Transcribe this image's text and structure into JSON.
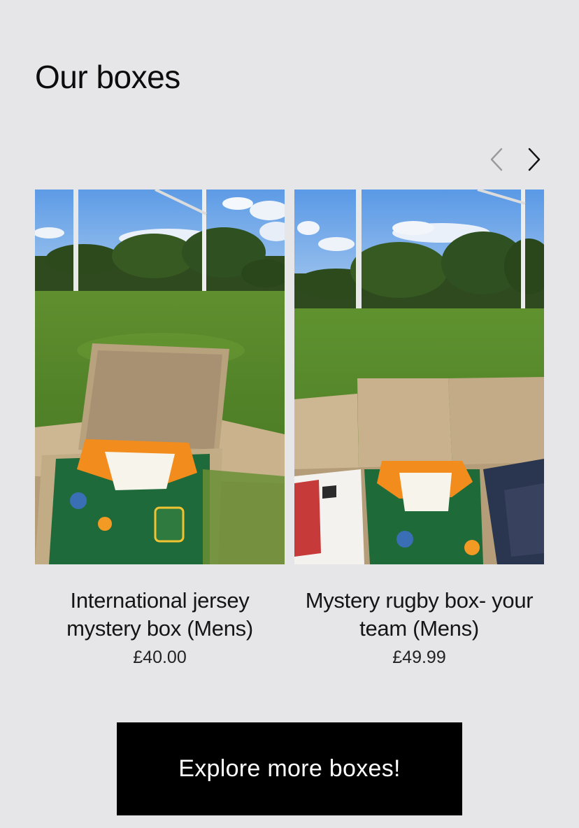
{
  "section": {
    "title": "Our boxes"
  },
  "carousel": {
    "prev_icon": "chevron-left-icon",
    "next_icon": "chevron-right-icon",
    "prev_color": "#9a9a9a",
    "next_color": "#111111"
  },
  "products": [
    {
      "name": "International jersey mystery box (Mens)",
      "price": "£40.00",
      "image": "green-gold-rugby-jersey-in-cardboard-box-on-field"
    },
    {
      "name": "Mystery rugby box- your team (Mens)",
      "price": "£49.99",
      "image": "three-rugby-jerseys-in-cardboard-boxes-on-field"
    }
  ],
  "cta": {
    "label": "Explore more boxes!"
  }
}
